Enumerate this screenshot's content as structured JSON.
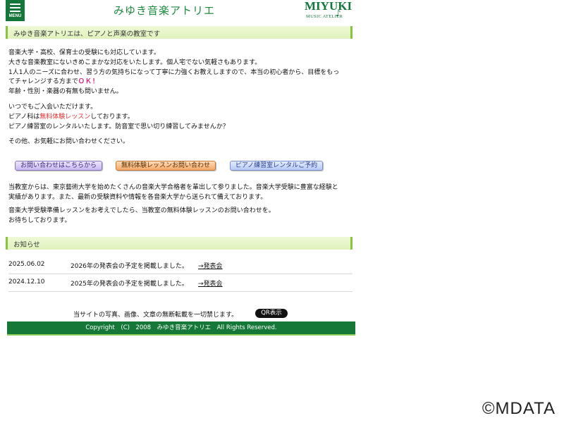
{
  "header": {
    "menu_label": "MENU",
    "site_title": "みゆき音楽アトリエ",
    "logo_main": "MIYUKI",
    "logo_sub": "MUSIC ATELIER"
  },
  "intro": {
    "heading": "みゆき音楽アトリエは、ピアノと声楽の教室です",
    "p1": [
      "音楽大学・高校、保育士の受験にも対応しています。",
      "大きな音楽教室にないきめこまかな対応をいたします。個人宅でない気軽さもあります。",
      "1人1人のニーズに合わせ、習う方の気持ちになって丁寧に力強くお教えしますので、本当の初心者から、目標をもっ"
    ],
    "p1_challenge": "てチャレンジする方まで",
    "p1_ok": "ＯＫ！",
    "p1_last": "年齢・性別・楽器の有無も問いません。",
    "p2_line1": "いつでもご入会いただけます。",
    "p2_piano_pre": "ピアノ科は",
    "p2_trial": "無料体験レッスン",
    "p2_piano_post": "しております。",
    "p2_line3": "ピアノ練習室のレンタルいたします。防音室で思い切り練習してみませんか？",
    "p3": "その他、お気軽にお問い合わせください。"
  },
  "buttons": {
    "contact": "お問い合わせはこちらから",
    "trial": "無料体験レッスンお問い合わせ",
    "rental": "ピアノ練習室レンタルご予約"
  },
  "achievements": {
    "line1": "当教室からは、東京藝術大学を始めたくさんの音楽大学合格者を輩出して参りました。音楽大学受験に豊富な経験と",
    "line2": "実績があります。また、最新の受験資料や情報を各音楽大学から送られて備えております。",
    "line3": "音楽大学受験準備レッスンをお考えでしたら、当教室の無料体験レッスンのお問い合わせを。",
    "line4": "お待ちしております。"
  },
  "news": {
    "heading": "お知らせ",
    "items": [
      {
        "date": "2025.06.02",
        "text": "2026年の発表会の予定を掲載しました。",
        "arrow": "→",
        "link": "発表会"
      },
      {
        "date": "2024.12.10",
        "text": "2025年の発表会の予定を掲載しました。",
        "arrow": "→",
        "link": "発表会"
      }
    ]
  },
  "footer": {
    "notice": "当サイトの写真、画像、文章の無断転載を一切禁じます。",
    "qr_label": "QR表示",
    "copyright": "Copyright　(C)　2008　みゆき音楽アトリエ　All Rights Reserved."
  },
  "watermark": "©MDATA",
  "colors": {
    "brand_green": "#157838",
    "heading_bg": "#e8f6cf",
    "accent_pink": "#e0197d",
    "accent_red": "#e53030"
  }
}
